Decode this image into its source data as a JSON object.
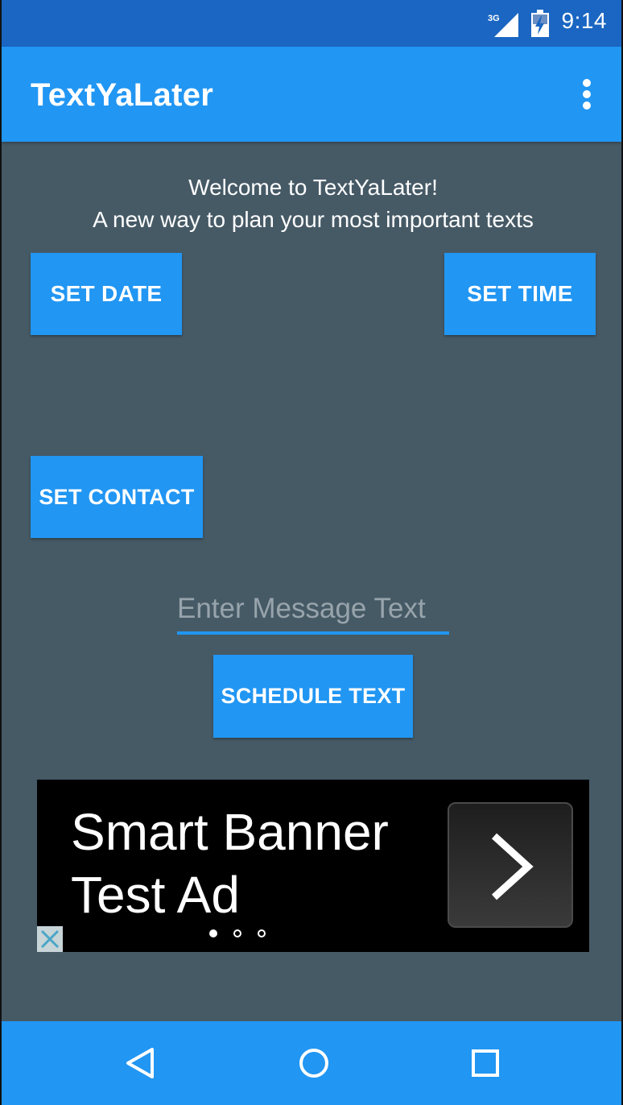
{
  "status_bar": {
    "time": "9:14",
    "network": "3G",
    "icons": [
      "signal-3g-icon",
      "battery-charging-icon"
    ]
  },
  "app_bar": {
    "title": "TextYaLater",
    "menu_icon": "overflow-menu-icon"
  },
  "main": {
    "welcome_line1": "Welcome to TextYaLater!",
    "welcome_line2": "A new way to plan your most important texts",
    "set_date_label": "SET DATE",
    "set_time_label": "SET TIME",
    "set_contact_label": "SET CONTACT",
    "message_placeholder": "Enter Message Text",
    "message_value": "",
    "schedule_label": "SCHEDULE TEXT"
  },
  "ad": {
    "text": "Smart Banner\nTest Ad",
    "arrow_icon": "chevron-right-icon",
    "close_icon": "close-icon",
    "page_count": 3,
    "active_page": 1
  },
  "nav_bar": {
    "icons": [
      "back-icon",
      "home-icon",
      "recents-icon"
    ]
  },
  "colors": {
    "status_bar": "#1a66c2",
    "primary": "#2196f3",
    "background": "#465a66",
    "ad_background": "#000000"
  }
}
